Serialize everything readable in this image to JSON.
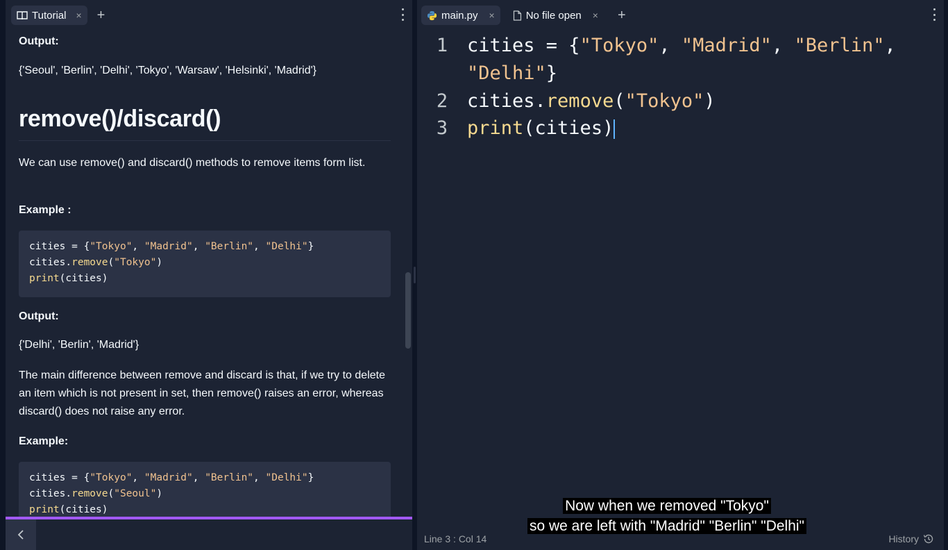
{
  "left_tab": {
    "label": "Tutorial",
    "close": "×",
    "add": "+"
  },
  "tutorial": {
    "output_label_1": "Output:",
    "output_1": "{'Seoul', 'Berlin', 'Delhi', 'Tokyo', 'Warsaw', 'Helsinki', 'Madrid'}",
    "heading": "remove()/discard()",
    "paragraph_1": "We can use remove() and discard() methods to remove items form list.",
    "example_label_1": "Example :",
    "code_1": {
      "l1": [
        "cities = {",
        "\"Tokyo\"",
        ", ",
        "\"Madrid\"",
        ", ",
        "\"Berlin\"",
        ", ",
        "\"Delhi\"",
        "}"
      ],
      "l2": [
        "cities.",
        "remove",
        "(",
        "\"Tokyo\"",
        ")"
      ],
      "l3": [
        "print",
        "(cities)"
      ]
    },
    "output_label_2": "Output:",
    "output_2": "{'Delhi', 'Berlin', 'Madrid'}",
    "paragraph_2": "The main difference between remove and discard is that, if we try to delete an item which is not present in set, then remove() raises an error, whereas discard() does not raise any error.",
    "example_label_2": "Example:",
    "code_2": {
      "l1": [
        "cities = {",
        "\"Tokyo\"",
        ", ",
        "\"Madrid\"",
        ", ",
        "\"Berlin\"",
        ", ",
        "\"Delhi\"",
        "}"
      ],
      "l2": [
        "cities.",
        "remove",
        "(",
        "\"Seoul\"",
        ")"
      ],
      "l3": [
        "print",
        "(cities)"
      ]
    }
  },
  "progress_percent": 100,
  "back_icon": "chevron-left",
  "right_tabs": [
    {
      "label": "main.py",
      "icon": "python-icon",
      "close": "×"
    },
    {
      "label": "No file open",
      "icon": "file-icon",
      "close": "×"
    }
  ],
  "right_tab_add": "+",
  "editor": {
    "lines": [
      {
        "num": "1",
        "parts": [
          "cities = {",
          "\"Tokyo\"",
          ", ",
          "\"Madrid\"",
          ", ",
          "\"Berlin\"",
          ","
        ]
      },
      {
        "num": "",
        "parts": [
          "\"Delhi\"",
          "}"
        ]
      },
      {
        "num": "2",
        "parts": [
          "cities.",
          "remove",
          "(",
          "\"Tokyo\"",
          ")"
        ]
      },
      {
        "num": "3",
        "parts": [
          "print",
          "(cities)"
        ]
      }
    ]
  },
  "status": {
    "position": "Line 3 : Col 14",
    "history": "History"
  },
  "subtitle": {
    "line1": "Now when we removed \"Tokyo\"",
    "line2": "so we are left with \"Madrid\" \"Berlin\" \"Delhi\""
  },
  "colors": {
    "background": "#1c2333",
    "string": "#f0c28f",
    "function": "#f5d98f",
    "progress": "#a259ff"
  }
}
